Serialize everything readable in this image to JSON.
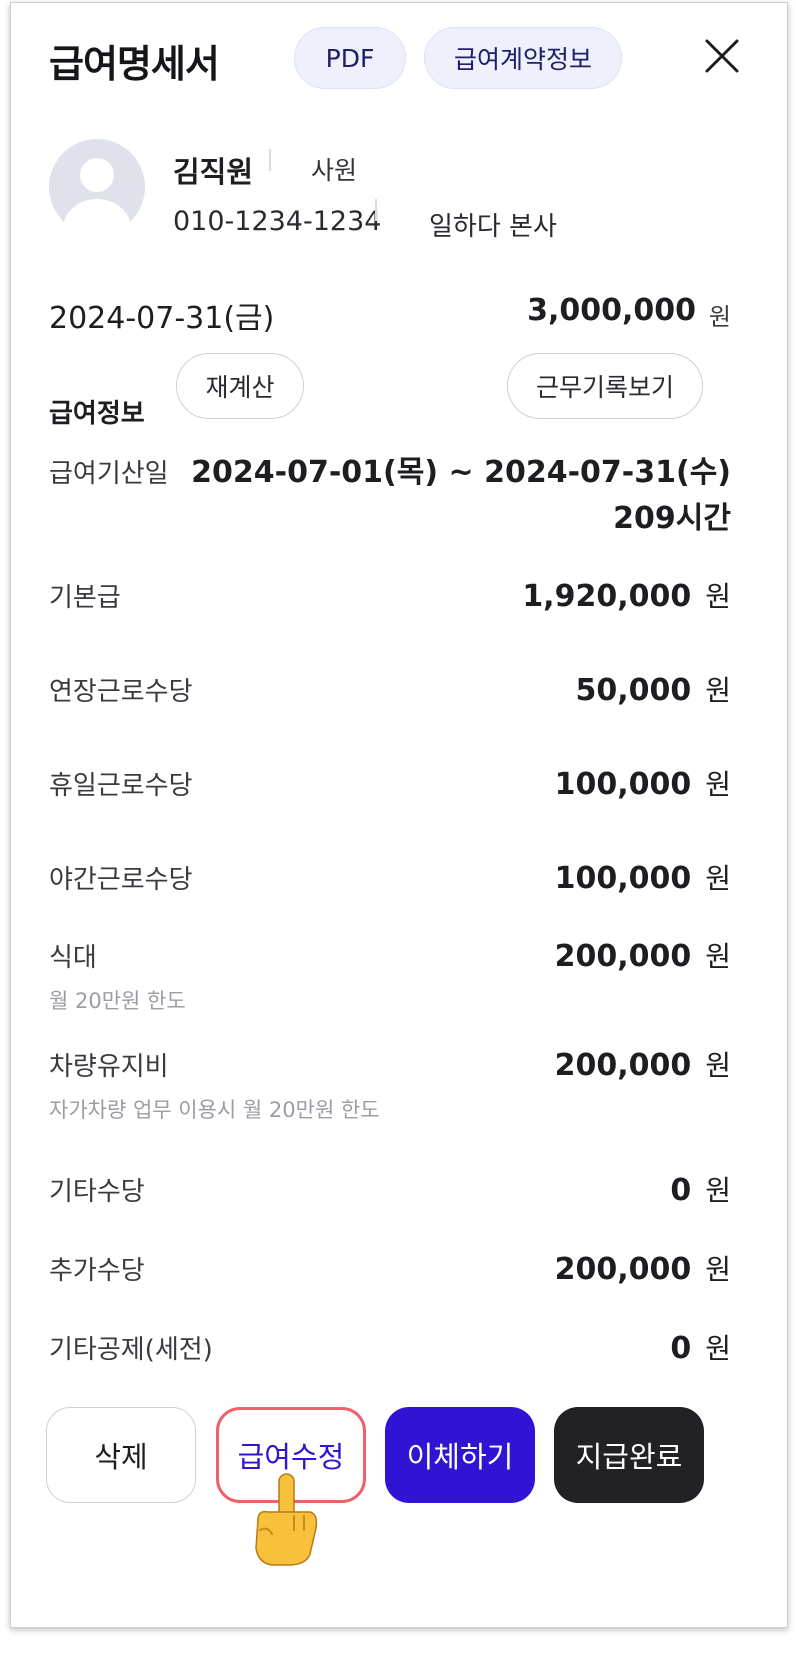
{
  "header": {
    "title": "급여명세서",
    "pdf_label": "PDF",
    "contract_label": "급여계약정보"
  },
  "employee": {
    "name": "김직원",
    "role": "사원",
    "phone": "010-1234-1234",
    "company": "일하다 본사"
  },
  "summary": {
    "date": "2024-07-31(금)",
    "amount": "3,000,000",
    "unit": "원"
  },
  "section": {
    "title": "급여정보",
    "recalc_label": "재계산",
    "worklog_label": "근무기록보기"
  },
  "period": {
    "label": "급여기산일",
    "range": "2024-07-01(목) ~ 2024-07-31(수)",
    "hours": "209시간"
  },
  "items": [
    {
      "label": "기본급",
      "value": "1,920,000",
      "unit": "원"
    },
    {
      "label": "연장근로수당",
      "value": "50,000",
      "unit": "원"
    },
    {
      "label": "휴일근로수당",
      "value": "100,000",
      "unit": "원"
    },
    {
      "label": "야간근로수당",
      "value": "100,000",
      "unit": "원"
    },
    {
      "label": "식대",
      "sub": "월 20만원 한도",
      "value": "200,000",
      "unit": "원"
    },
    {
      "label": "차량유지비",
      "sub": "자가차량 업무 이용시 월 20만원 한도",
      "value": "200,000",
      "unit": "원"
    },
    {
      "label": "기타수당",
      "value": "0",
      "unit": "원"
    },
    {
      "label": "추가수당",
      "value": "200,000",
      "unit": "원"
    },
    {
      "label": "기타공제(세전)",
      "value": "0",
      "unit": "원"
    }
  ],
  "actions": {
    "delete_label": "삭제",
    "edit_label": "급여수정",
    "transfer_label": "이체하기",
    "complete_label": "지급완료"
  },
  "colors": {
    "primary": "#3014d4",
    "dark": "#222226",
    "highlight": "#f0606a"
  },
  "icons": {
    "close": "close-icon",
    "pointer": "pointing-hand-icon"
  }
}
